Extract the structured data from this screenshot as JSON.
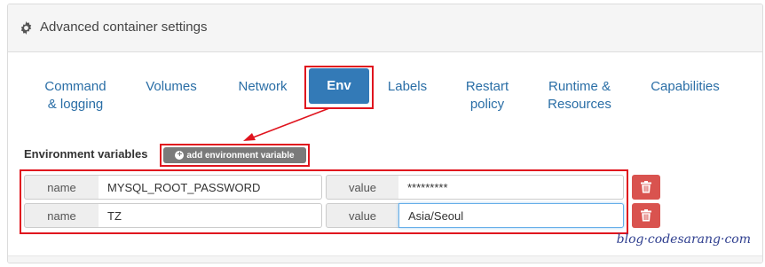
{
  "panel": {
    "title": "Advanced container settings",
    "icon": "gear-icon"
  },
  "tabs": [
    {
      "line1": "Command",
      "line2": "& logging"
    },
    {
      "line1": "Volumes",
      "line2": ""
    },
    {
      "line1": "Network",
      "line2": ""
    },
    {
      "line1": "Env",
      "line2": "",
      "active": true
    },
    {
      "line1": "Labels",
      "line2": ""
    },
    {
      "line1": "Restart",
      "line2": "policy"
    },
    {
      "line1": "Runtime &",
      "line2": "Resources"
    },
    {
      "line1": "Capabilities",
      "line2": ""
    }
  ],
  "env": {
    "section_label": "Environment variables",
    "add_button": "add environment variable",
    "rows": [
      {
        "name_label": "name",
        "name_value": "MYSQL_ROOT_PASSWORD",
        "value_label": "value",
        "value_value": "*********"
      },
      {
        "name_label": "name",
        "name_value": "TZ",
        "value_label": "value",
        "value_value": "Asia/Seoul"
      }
    ]
  },
  "colors": {
    "accent": "#337ab7",
    "highlight": "#e0141e",
    "danger": "#d9534f",
    "link": "#2a6ea6"
  },
  "watermark": "blog·codesarang·com"
}
